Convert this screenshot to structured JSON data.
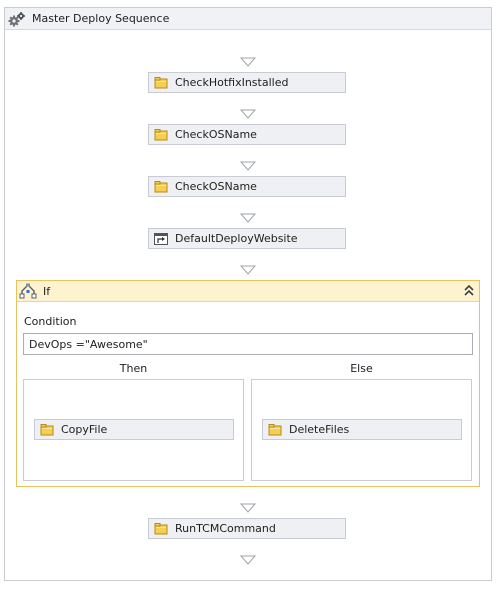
{
  "sequence": {
    "title": "Master Deploy Sequence",
    "icon": "gears-icon"
  },
  "activities": [
    {
      "label": "CheckHotfixInstalled",
      "icon": "folder-activity-icon"
    },
    {
      "label": "CheckOSName",
      "icon": "folder-activity-icon"
    },
    {
      "label": "CheckOSName",
      "icon": "folder-activity-icon"
    },
    {
      "label": "DefaultDeployWebsite",
      "icon": "window-activity-icon"
    }
  ],
  "if_block": {
    "title": "If",
    "icon": "if-condition-icon",
    "condition_label": "Condition",
    "condition_value": "DevOps =\"Awesome\"",
    "then_label": "Then",
    "else_label": "Else",
    "then_activity": {
      "label": "CopyFile",
      "icon": "folder-activity-icon"
    },
    "else_activity": {
      "label": "DeleteFiles",
      "icon": "folder-activity-icon"
    }
  },
  "final_activity": {
    "label": "RunTCMCommand",
    "icon": "folder-activity-icon"
  },
  "colors": {
    "if_border": "#e6c35c",
    "if_header_bg": "#fdf4cf",
    "activity_bg": "#eef0f3"
  }
}
